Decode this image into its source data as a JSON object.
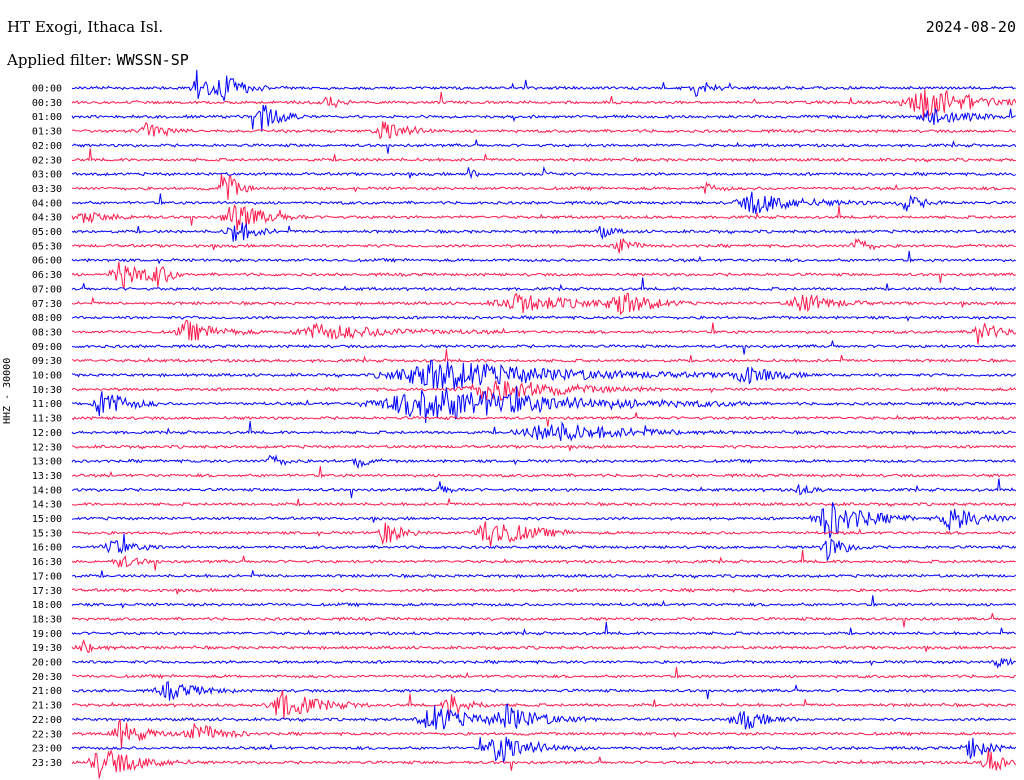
{
  "header": {
    "station": "HT Exogi, Ithaca Isl.",
    "date": "2024-08-20",
    "filter_label": "Applied filter: ",
    "filter_value": "WWSSN-SP"
  },
  "channel_label": "HHZ - 30000",
  "colors": {
    "trace_a": "#0000ff",
    "trace_b": "#ff1a4d",
    "background": "#ffffff"
  },
  "chart_data": {
    "type": "line",
    "title": "",
    "xlabel": "",
    "ylabel": "HHZ - 30000",
    "row_labels": [
      "00:00",
      "00:30",
      "01:00",
      "01:30",
      "02:00",
      "02:30",
      "03:00",
      "03:30",
      "04:00",
      "04:30",
      "05:00",
      "05:30",
      "06:00",
      "06:30",
      "07:00",
      "07:30",
      "08:00",
      "08:30",
      "09:00",
      "09:30",
      "10:00",
      "10:30",
      "11:00",
      "11:30",
      "12:00",
      "12:30",
      "13:00",
      "13:30",
      "14:00",
      "14:30",
      "15:00",
      "15:30",
      "16:00",
      "16:30",
      "17:00",
      "17:30",
      "18:00",
      "18:30",
      "19:00",
      "19:30",
      "20:00",
      "20:30",
      "21:00",
      "21:30",
      "22:00",
      "22:30",
      "23:00",
      "23:30"
    ],
    "row_colors": [
      "trace_a",
      "trace_b"
    ],
    "events": [
      {
        "row": 0,
        "t": 0.13,
        "amp": 3.2,
        "dur": 0.02
      },
      {
        "row": 0,
        "t": 0.16,
        "amp": 2.5,
        "dur": 0.03
      },
      {
        "row": 0,
        "t": 0.66,
        "amp": 1.8,
        "dur": 0.02
      },
      {
        "row": 1,
        "t": 0.9,
        "amp": 2.6,
        "dur": 0.08
      },
      {
        "row": 1,
        "t": 0.27,
        "amp": 1.4,
        "dur": 0.02
      },
      {
        "row": 2,
        "t": 0.2,
        "amp": 2.2,
        "dur": 0.03
      },
      {
        "row": 2,
        "t": 0.91,
        "amp": 1.6,
        "dur": 0.05
      },
      {
        "row": 3,
        "t": 0.08,
        "amp": 1.5,
        "dur": 0.03
      },
      {
        "row": 3,
        "t": 0.33,
        "amp": 1.8,
        "dur": 0.04
      },
      {
        "row": 6,
        "t": 0.42,
        "amp": 1.1,
        "dur": 0.01
      },
      {
        "row": 6,
        "t": 0.5,
        "amp": 1.0,
        "dur": 0.01
      },
      {
        "row": 7,
        "t": 0.16,
        "amp": 3.5,
        "dur": 0.02
      },
      {
        "row": 7,
        "t": 0.67,
        "amp": 0.8,
        "dur": 0.02
      },
      {
        "row": 8,
        "t": 0.72,
        "amp": 1.6,
        "dur": 0.08
      },
      {
        "row": 8,
        "t": 0.88,
        "amp": 1.4,
        "dur": 0.03
      },
      {
        "row": 9,
        "t": 0.17,
        "amp": 2.4,
        "dur": 0.05
      },
      {
        "row": 9,
        "t": 0.01,
        "amp": 0.8,
        "dur": 0.05
      },
      {
        "row": 10,
        "t": 0.17,
        "amp": 2.2,
        "dur": 0.03
      },
      {
        "row": 10,
        "t": 0.56,
        "amp": 1.0,
        "dur": 0.02
      },
      {
        "row": 11,
        "t": 0.58,
        "amp": 1.6,
        "dur": 0.02
      },
      {
        "row": 11,
        "t": 0.83,
        "amp": 1.5,
        "dur": 0.02
      },
      {
        "row": 13,
        "t": 0.05,
        "amp": 2.4,
        "dur": 0.04
      },
      {
        "row": 13,
        "t": 0.09,
        "amp": 1.6,
        "dur": 0.02
      },
      {
        "row": 15,
        "t": 0.47,
        "amp": 1.4,
        "dur": 0.1
      },
      {
        "row": 15,
        "t": 0.58,
        "amp": 1.8,
        "dur": 0.05
      },
      {
        "row": 15,
        "t": 0.77,
        "amp": 1.6,
        "dur": 0.05
      },
      {
        "row": 17,
        "t": 0.12,
        "amp": 1.6,
        "dur": 0.05
      },
      {
        "row": 17,
        "t": 0.26,
        "amp": 1.2,
        "dur": 0.12
      },
      {
        "row": 17,
        "t": 0.96,
        "amp": 1.8,
        "dur": 0.03
      },
      {
        "row": 20,
        "t": 0.38,
        "amp": 2.4,
        "dur": 0.2
      },
      {
        "row": 20,
        "t": 0.71,
        "amp": 1.5,
        "dur": 0.05
      },
      {
        "row": 21,
        "t": 0.44,
        "amp": 1.8,
        "dur": 0.12
      },
      {
        "row": 22,
        "t": 0.03,
        "amp": 2.4,
        "dur": 0.04
      },
      {
        "row": 22,
        "t": 0.37,
        "amp": 2.8,
        "dur": 0.22
      },
      {
        "row": 24,
        "t": 0.5,
        "amp": 1.6,
        "dur": 0.12
      },
      {
        "row": 26,
        "t": 0.21,
        "amp": 1.2,
        "dur": 0.02
      },
      {
        "row": 26,
        "t": 0.3,
        "amp": 1.0,
        "dur": 0.02
      },
      {
        "row": 28,
        "t": 0.39,
        "amp": 0.8,
        "dur": 0.02
      },
      {
        "row": 28,
        "t": 0.77,
        "amp": 0.9,
        "dur": 0.02
      },
      {
        "row": 30,
        "t": 0.8,
        "amp": 3.0,
        "dur": 0.06
      },
      {
        "row": 30,
        "t": 0.93,
        "amp": 2.0,
        "dur": 0.05
      },
      {
        "row": 31,
        "t": 0.44,
        "amp": 2.6,
        "dur": 0.06
      },
      {
        "row": 31,
        "t": 0.33,
        "amp": 1.8,
        "dur": 0.03
      },
      {
        "row": 32,
        "t": 0.8,
        "amp": 1.8,
        "dur": 0.03
      },
      {
        "row": 32,
        "t": 0.04,
        "amp": 1.2,
        "dur": 0.04
      },
      {
        "row": 33,
        "t": 0.05,
        "amp": 1.0,
        "dur": 0.03
      },
      {
        "row": 39,
        "t": 0.01,
        "amp": 1.0,
        "dur": 0.03
      },
      {
        "row": 40,
        "t": 0.98,
        "amp": 1.0,
        "dur": 0.02
      },
      {
        "row": 42,
        "t": 0.1,
        "amp": 1.4,
        "dur": 0.05
      },
      {
        "row": 43,
        "t": 0.22,
        "amp": 2.2,
        "dur": 0.06
      },
      {
        "row": 43,
        "t": 0.4,
        "amp": 2.0,
        "dur": 0.03
      },
      {
        "row": 44,
        "t": 0.38,
        "amp": 2.2,
        "dur": 0.06
      },
      {
        "row": 44,
        "t": 0.46,
        "amp": 2.0,
        "dur": 0.06
      },
      {
        "row": 44,
        "t": 0.71,
        "amp": 1.6,
        "dur": 0.04
      },
      {
        "row": 45,
        "t": 0.05,
        "amp": 2.2,
        "dur": 0.04
      },
      {
        "row": 45,
        "t": 0.13,
        "amp": 1.8,
        "dur": 0.04
      },
      {
        "row": 46,
        "t": 0.45,
        "amp": 2.4,
        "dur": 0.06
      },
      {
        "row": 46,
        "t": 0.95,
        "amp": 1.8,
        "dur": 0.03
      },
      {
        "row": 47,
        "t": 0.03,
        "amp": 2.4,
        "dur": 0.06
      },
      {
        "row": 47,
        "t": 0.97,
        "amp": 2.0,
        "dur": 0.03
      }
    ]
  }
}
